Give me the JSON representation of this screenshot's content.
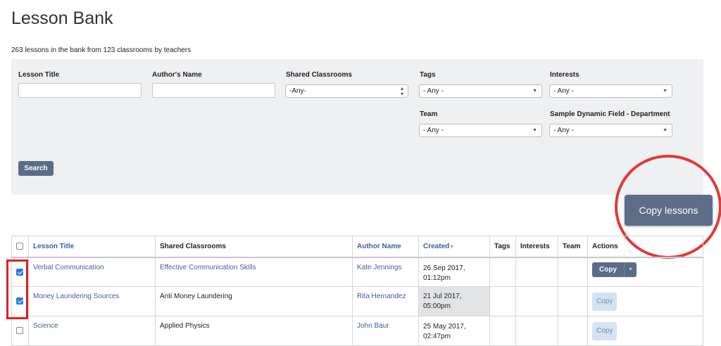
{
  "page": {
    "title": "Lesson Bank",
    "summary": "263 lessons in the bank from 123 classrooms by teachers"
  },
  "filters": {
    "lesson_title": {
      "label": "Lesson Title",
      "value": "",
      "placeholder": ""
    },
    "author_name": {
      "label": "Author's Name",
      "value": "",
      "placeholder": ""
    },
    "shared_classrooms": {
      "label": "Shared Classrooms",
      "selected": "-Any-"
    },
    "tags": {
      "label": "Tags",
      "selected": "- Any -"
    },
    "interests": {
      "label": "Interests",
      "selected": "- Any -"
    },
    "team": {
      "label": "Team",
      "selected": "- Any -"
    },
    "department": {
      "label": "Sample Dynamic Field - Department",
      "selected": "- Any -"
    },
    "search_label": "Search"
  },
  "copy_lessons_label": "Copy lessons",
  "table": {
    "headers": {
      "lesson_title": "Lesson Title",
      "shared_classrooms": "Shared Classrooms",
      "author_name": "Author Name",
      "created": "Created",
      "tags": "Tags",
      "interests": "Interests",
      "team": "Team",
      "actions": "Actions"
    },
    "rows": [
      {
        "checked": true,
        "lesson_title": "Verbal Communication",
        "shared_classrooms": "Effective Communication Skills",
        "author": "Kate Jennings",
        "created_date": "26 Sep 2017,",
        "created_time": "01:12pm",
        "action": "Copy"
      },
      {
        "checked": true,
        "lesson_title": "Money Laundering Sources",
        "shared_classrooms": "Anti Money Laundering",
        "author": "Rita Hernandez",
        "created_date": "21 Jul 2017,",
        "created_time": "05:00pm",
        "action": "Copy"
      },
      {
        "checked": false,
        "lesson_title": "Science",
        "shared_classrooms": "Applied Physics",
        "author": "John Baur",
        "created_date": "25 May 2017,",
        "created_time": "02:47pm",
        "action": "Copy"
      }
    ]
  },
  "colors": {
    "accent": "#5a6c88",
    "link": "#3f5f9c",
    "highlight": "#e03a3a",
    "checkbox_checked": "#2a7bd9"
  },
  "icons": {
    "select_arrow": "caret-down-icon",
    "sort": "sort-down-icon",
    "dropdown": "caret-down-icon"
  }
}
